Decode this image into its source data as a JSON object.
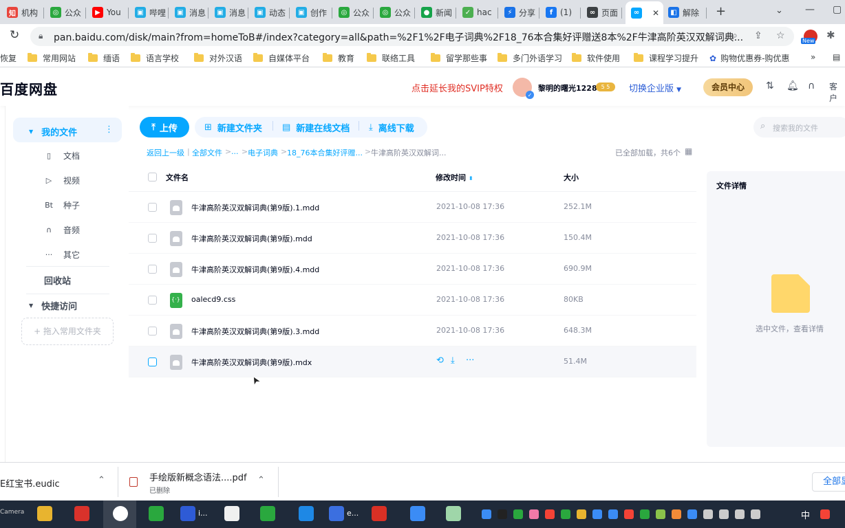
{
  "browser": {
    "tabs": [
      {
        "label": "机构",
        "color": "#e8453c",
        "glyph": "知"
      },
      {
        "label": "公众",
        "color": "#2aa83e",
        "glyph": "◎"
      },
      {
        "label": "You",
        "color": "#ff0000",
        "glyph": "▶"
      },
      {
        "label": "哔哩",
        "color": "#23ade5",
        "glyph": "▣"
      },
      {
        "label": "消息",
        "color": "#23ade5",
        "glyph": "▣"
      },
      {
        "label": "消息",
        "color": "#23ade5",
        "glyph": "▣"
      },
      {
        "label": "动态",
        "color": "#23ade5",
        "glyph": "▣"
      },
      {
        "label": "创作",
        "color": "#23ade5",
        "glyph": "▣"
      },
      {
        "label": "公众",
        "color": "#2aa83e",
        "glyph": "◎"
      },
      {
        "label": "公众",
        "color": "#2aa83e",
        "glyph": "◎"
      },
      {
        "label": "新闻",
        "color": "#16a34a",
        "glyph": "●"
      },
      {
        "label": "hac",
        "color": "#4caf50",
        "glyph": "✓"
      },
      {
        "label": "分享",
        "color": "#1a73e8",
        "glyph": "⚡"
      },
      {
        "label": "(1)",
        "color": "#1877f2",
        "glyph": "f"
      },
      {
        "label": "页面",
        "color": "#3c4043",
        "glyph": "∞"
      },
      {
        "label": "",
        "color": "#06a7ff",
        "glyph": "∞"
      },
      {
        "label": "解除",
        "color": "#1a73e8",
        "glyph": "◧"
      }
    ],
    "new_tab_glyph": "+",
    "url": "pan.baidu.com/disk/main?from=homeToB#/index?category=all&path=%2F1%2F电子词典%2F18_76本合集好评赠送8本%2F牛津高阶英汉双解词典...",
    "bookmarks": [
      "恢复",
      "常用网站",
      "缅语",
      "语言学校",
      "对外汉语",
      "自媒体平台",
      "教育",
      "联络工具",
      "留学那些事",
      "多门外语学习",
      "软件使用",
      "课程学习提升",
      "购物优惠券-购优惠"
    ],
    "new_badge": "New"
  },
  "app": {
    "logo": "百度网盘",
    "svip_promo": "点击延长我的SVIP特权",
    "username": "黎明的曙光1228",
    "level": "5 5",
    "switch_label": "切换企业版",
    "vip_center": "会员中心",
    "client_label": "客户"
  },
  "sidebar": {
    "my_files": "我的文件",
    "items": [
      {
        "label": "文档",
        "icon": "document-icon",
        "glyph": "▯"
      },
      {
        "label": "视频",
        "icon": "video-icon",
        "glyph": "▷"
      },
      {
        "label": "种子",
        "icon": "torrent-icon",
        "glyph": "Bt"
      },
      {
        "label": "音频",
        "icon": "headphone-icon",
        "glyph": "∩"
      },
      {
        "label": "其它",
        "icon": "more-icon",
        "glyph": "···"
      }
    ],
    "recycle": "回收站",
    "quick_access": "快捷访问",
    "drag_hint": "+ 拖入常用文件夹"
  },
  "toolbar": {
    "upload": "上传",
    "new_folder": "新建文件夹",
    "new_doc": "新建在线文档",
    "offline": "离线下载",
    "search_placeholder": "搜索我的文件"
  },
  "breadcrumb": {
    "back": "返回上一级",
    "all": "全部文件",
    "ellipsis": "...",
    "dict": "电子词典",
    "collection": "18_76本合集好评赠...",
    "current": "牛津高阶英汉双解词...",
    "status": "已全部加载，共6个"
  },
  "table": {
    "columns": {
      "name": "文件名",
      "time": "修改时间",
      "size": "大小"
    },
    "rows": [
      {
        "name": "牛津高阶英汉双解词典(第9版).1.mdd",
        "time": "2021-10-08 17:36",
        "size": "252.1M",
        "type": "file"
      },
      {
        "name": "牛津高阶英汉双解词典(第9版).mdd",
        "time": "2021-10-08 17:36",
        "size": "150.4M",
        "type": "file"
      },
      {
        "name": "牛津高阶英汉双解词典(第9版).4.mdd",
        "time": "2021-10-08 17:36",
        "size": "690.9M",
        "type": "file"
      },
      {
        "name": "oalecd9.css",
        "time": "2021-10-08 17:36",
        "size": "80KB",
        "type": "css"
      },
      {
        "name": "牛津高阶英汉双解词典(第9版).3.mdd",
        "time": "2021-10-08 17:36",
        "size": "648.3M",
        "type": "file"
      },
      {
        "name": "牛津高阶英汉双解词典(第9版).mdx",
        "time": "",
        "size": "51.4M",
        "type": "file"
      }
    ]
  },
  "details": {
    "title": "文件详情",
    "empty_hint": "选中文件，查看详情"
  },
  "downloads": {
    "item1": "E红宝书.eudic",
    "item2_name": "手绘版新概念语法....pdf",
    "item2_status": "已删除",
    "show_all": "全部显"
  },
  "taskbar": {
    "camera": "Camera",
    "ime": "中",
    "label_i": "i...",
    "label_e": "e..."
  },
  "colors": {
    "accent": "#06a7ff",
    "promo": "#e02e24",
    "taskbar": "#1f2a3a"
  }
}
